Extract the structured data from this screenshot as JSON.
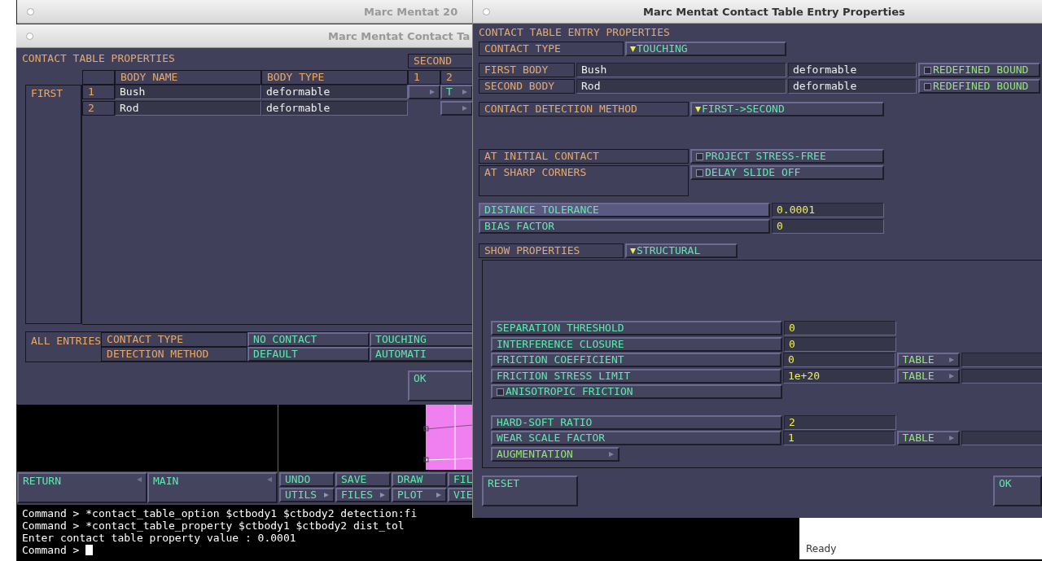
{
  "main_window": {
    "title": "Marc Mentat 20",
    "menu_buttons": [
      {
        "label": "RETURN"
      },
      {
        "label": "MAIN"
      }
    ],
    "tool_buttons": [
      {
        "label": "UNDO",
        "arrow": false
      },
      {
        "label": "SAVE",
        "arrow": false
      },
      {
        "label": "DRAW",
        "arrow": false
      },
      {
        "label": "FIL"
      },
      {
        "label": "UTILS",
        "arrow": true
      },
      {
        "label": "FILES",
        "arrow": true
      },
      {
        "label": "PLOT",
        "arrow": true
      },
      {
        "label": "VIE"
      }
    ],
    "command_lines": [
      "Command > *contact_table_option $ctbody1 $ctbody2 detection:fi",
      "Command > *contact_table_property $ctbody1 $ctbody2 dist_tol",
      "Enter contact table property value : 0.0001",
      "Command >"
    ],
    "status": "Ready"
  },
  "table_dialog": {
    "title": "Marc Mentat Contact Ta",
    "heading": "CONTACT TABLE PROPERTIES",
    "second_label": "SECOND",
    "first_label": "FIRST",
    "columns": [
      "BODY NAME",
      "BODY TYPE"
    ],
    "second_columns": [
      "1",
      "2"
    ],
    "rows": [
      {
        "index": "1",
        "name": "Bush",
        "type": "deformable",
        "cells": [
          {
            "kind": "button"
          },
          {
            "kind": "button",
            "value": "T"
          }
        ]
      },
      {
        "index": "2",
        "name": "Rod",
        "type": "deformable",
        "cells": [
          {
            "kind": "none"
          },
          {
            "kind": "button"
          }
        ]
      }
    ],
    "all_entries": {
      "label": "ALL ENTRIES",
      "rows": [
        {
          "label": "CONTACT TYPE",
          "options": [
            "NO CONTACT",
            "TOUCHING"
          ]
        },
        {
          "label": "DETECTION METHOD",
          "options": [
            "DEFAULT",
            "AUTOMATI"
          ]
        }
      ]
    },
    "ok": "OK"
  },
  "entry_dialog": {
    "title": "Marc Mentat Contact Table Entry Properties",
    "heading": "CONTACT TABLE ENTRY PROPERTIES",
    "contact_type": {
      "label": "CONTACT TYPE",
      "value": "TOUCHING"
    },
    "bodies": [
      {
        "label": "FIRST BODY",
        "name": "Bush",
        "type": "deformable",
        "option": "REDEFINED BOUND",
        "checked": false
      },
      {
        "label": "SECOND BODY",
        "name": "Rod",
        "type": "deformable",
        "option": "REDEFINED BOUND",
        "checked": false
      }
    ],
    "detection": {
      "label": "CONTACT DETECTION METHOD",
      "value": "FIRST->SECOND"
    },
    "contact_options": [
      {
        "label": "AT INITIAL CONTACT",
        "option": "PROJECT STRESS-FREE",
        "checked": false
      },
      {
        "label": "AT SHARP CORNERS",
        "option": "DELAY SLIDE OFF",
        "checked": false
      }
    ],
    "tolerances": [
      {
        "label": "DISTANCE TOLERANCE",
        "value": "0.0001",
        "selected": true
      },
      {
        "label": "BIAS FACTOR",
        "value": "0",
        "selected": false
      }
    ],
    "show_properties": {
      "label": "SHOW PROPERTIES",
      "value": "STRUCTURAL"
    },
    "property_groups": [
      [
        {
          "kind": "field",
          "label": "SEPARATION THRESHOLD",
          "value": "0"
        },
        {
          "kind": "field",
          "label": "INTERFERENCE CLOSURE",
          "value": "0"
        },
        {
          "kind": "field",
          "label": "FRICTION COEFFICIENT",
          "value": "0",
          "table": "TABLE"
        },
        {
          "kind": "field",
          "label": "FRICTION STRESS LIMIT",
          "value": "1e+20",
          "table": "TABLE"
        },
        {
          "kind": "checkbox",
          "label": "ANISOTROPIC FRICTION",
          "checked": false
        }
      ],
      [
        {
          "kind": "field",
          "label": "HARD-SOFT RATIO",
          "value": "2"
        },
        {
          "kind": "field",
          "label": "WEAR SCALE FACTOR",
          "value": "1",
          "table": "TABLE"
        },
        {
          "kind": "menu",
          "label": "AUGMENTATION"
        }
      ]
    ],
    "reset": "RESET",
    "ok": "OK"
  }
}
